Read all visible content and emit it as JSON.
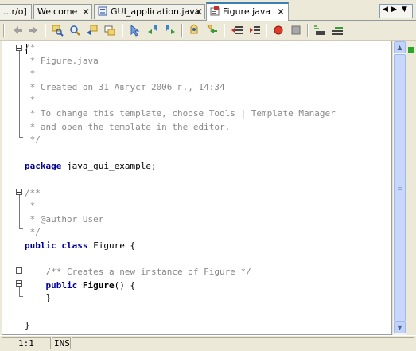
{
  "tabs": [
    {
      "label": "...r/o]"
    },
    {
      "label": "Welcome"
    },
    {
      "label": "GUI_application.java"
    },
    {
      "label": "Figure.java",
      "active": true
    }
  ],
  "code_lines": [
    {
      "text": "/*",
      "kind": "comment"
    },
    {
      "text": " * Figure.java",
      "kind": "comment"
    },
    {
      "text": " *",
      "kind": "comment"
    },
    {
      "text": " * Created on 31 Август 2006 г., 14:34",
      "kind": "comment"
    },
    {
      "text": " *",
      "kind": "comment"
    },
    {
      "text": " * To change this template, choose Tools | Template Manager",
      "kind": "comment"
    },
    {
      "text": " * and open the template in the editor.",
      "kind": "comment"
    },
    {
      "text": " */",
      "kind": "comment"
    },
    {
      "text": "",
      "kind": "plain"
    },
    {
      "kw": "package",
      "rest": " java_gui_example;",
      "kind": "keyword"
    },
    {
      "text": "",
      "kind": "plain"
    },
    {
      "text": "/**",
      "kind": "comment"
    },
    {
      "text": " *",
      "kind": "comment"
    },
    {
      "text": " * @author User",
      "kind": "comment"
    },
    {
      "text": " */",
      "kind": "comment"
    },
    {
      "kw": "public class",
      "rest": " Figure {",
      "kind": "keyword"
    },
    {
      "text": "",
      "kind": "plain"
    },
    {
      "text": "    /** Creates a new instance of Figure */",
      "kind": "comment"
    },
    {
      "pre": "    ",
      "kw": "public",
      "bold": " Figure",
      "rest": "() {",
      "kind": "keyword"
    },
    {
      "text": "    }",
      "kind": "plain"
    },
    {
      "text": "",
      "kind": "plain"
    },
    {
      "text": "}",
      "kind": "plain"
    }
  ],
  "status": {
    "position": "1:1",
    "mode": "INS"
  },
  "icons": {
    "tab_close": "close-icon",
    "file": "java-file-icon",
    "toolbar": [
      "back-icon",
      "forward-icon",
      "find-selection-icon",
      "find-icon",
      "find-previous-icon",
      "find-next-icon",
      "toggle-highlight-icon",
      "previous-bookmark-icon",
      "next-bookmark-icon",
      "toggle-bookmark-icon",
      "shift-left-icon",
      "shift-right-icon",
      "record-macro-icon",
      "stop-macro-icon",
      "comment-icon",
      "uncomment-icon"
    ]
  },
  "colors": {
    "keyword": "#000099",
    "comment": "#888888",
    "tab_accent": "#3c7fb1",
    "error_stripe_ok": "#2aa52a"
  }
}
